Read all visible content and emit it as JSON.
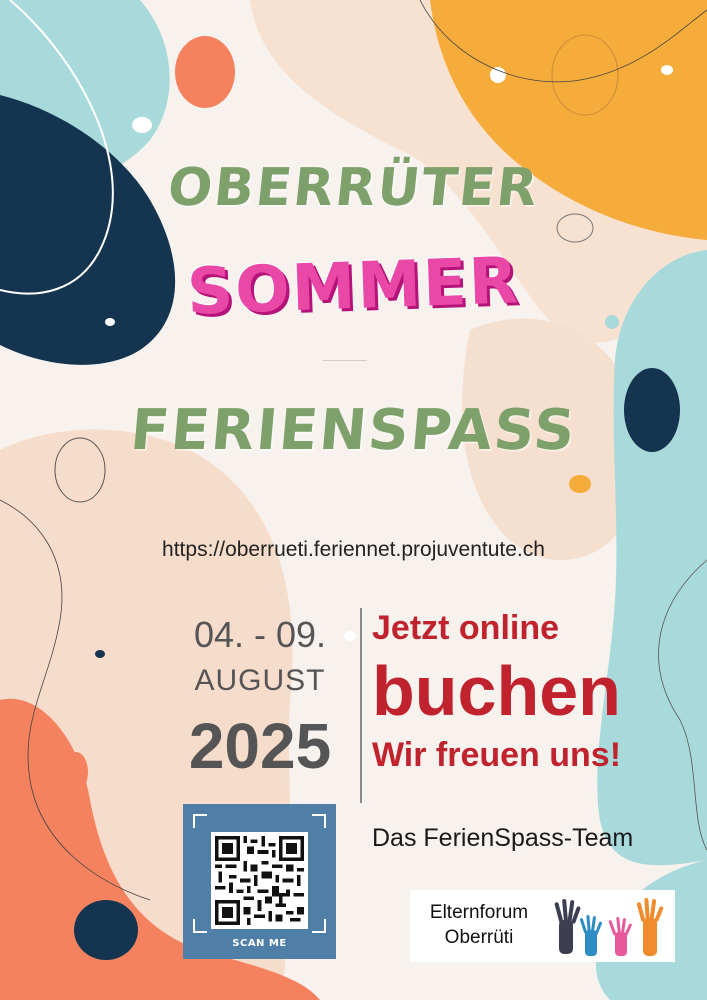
{
  "poster": {
    "title_line1": "OBERRÜTER",
    "title_line2": "SOMMER",
    "title_line3": "FERIENSPASS",
    "url": "https://oberrueti.feriennet.projuventute.ch",
    "dates": {
      "range": "04. - 09.",
      "month": "AUGUST",
      "year": "2025"
    },
    "cta": {
      "line1": "Jetzt online",
      "line2": "buchen",
      "line3": "Wir freuen uns!"
    },
    "signature": "Das FerienSpass-Team",
    "qr": {
      "caption": "SCAN ME"
    },
    "sponsor": {
      "line1": "Elternforum",
      "line2": "Oberrüti"
    }
  },
  "colors": {
    "title_green": "#7ea06b",
    "title_pink": "#ea48a6",
    "cta_red": "#c0232e",
    "navy": "#14344f",
    "teal": "#a9dadb",
    "orange": "#f6ac3b",
    "coral": "#f4825f",
    "peach": "#f6dccb",
    "qr_blue": "#4f7fa7"
  },
  "icons": [
    "hands-icon",
    "qr-code"
  ]
}
